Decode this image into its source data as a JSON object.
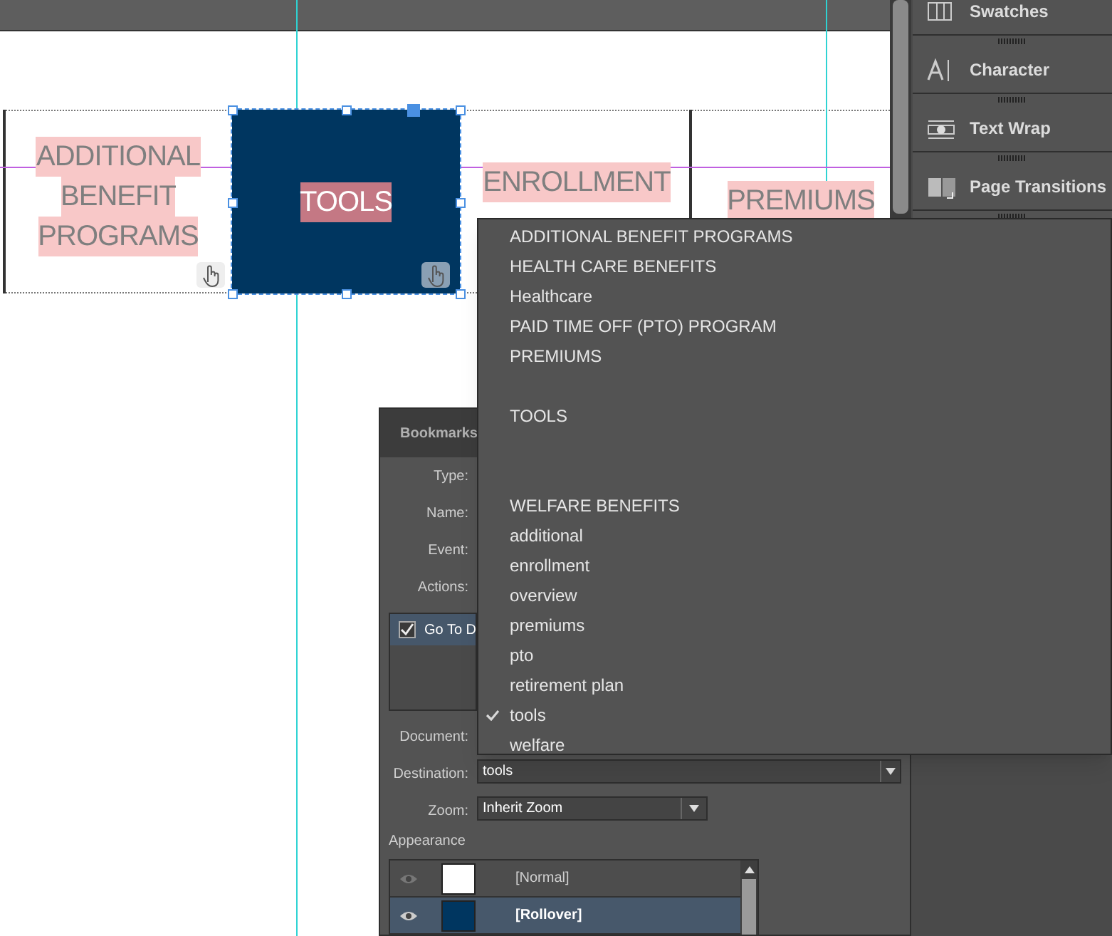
{
  "canvas_buttons": [
    {
      "lines": [
        "ADDITIONAL",
        "BENEFIT",
        "PROGRAMS"
      ],
      "selected": false,
      "hand_icon": true
    },
    {
      "lines": [
        "TOOLS"
      ],
      "selected": true,
      "hand_icon": true
    },
    {
      "lines": [
        "ENROLLMENT"
      ],
      "selected": false,
      "hand_icon": false
    },
    {
      "lines": [
        "PREMIUMS"
      ],
      "selected": false,
      "hand_icon": false
    }
  ],
  "side_panels": [
    {
      "kind": "swatches",
      "label": "Swatches"
    },
    {
      "kind": "character",
      "label": "Character"
    },
    {
      "kind": "text-wrap",
      "label": "Text Wrap"
    },
    {
      "kind": "page-transitions",
      "label": "Page Transitions"
    }
  ],
  "bookmarks_panel": {
    "title": "Bookmarks",
    "field_labels": [
      "Type:",
      "Name:",
      "Event:",
      "Actions:"
    ],
    "actions": [
      {
        "label": "Go To D",
        "checked": true
      }
    ],
    "document_label": "Document:",
    "destination": {
      "label": "Destination:",
      "value": "tools"
    },
    "zoom": {
      "label": "Zoom:",
      "value": "Inherit Zoom"
    },
    "appearance_label": "Appearance",
    "appearance": [
      {
        "label": "[Normal]",
        "selected": false,
        "color": "#ffffff"
      },
      {
        "label": "[Rollover]",
        "selected": true,
        "color": "#003660"
      }
    ]
  },
  "dropdown_menu": [
    {
      "kind": "item",
      "label": "ADDITIONAL BENEFIT PROGRAMS",
      "checked": false
    },
    {
      "kind": "item",
      "label": "HEALTH CARE BENEFITS",
      "checked": false
    },
    {
      "kind": "item",
      "label": "Healthcare",
      "checked": false
    },
    {
      "kind": "item",
      "label": "PAID TIME OFF (PTO) PROGRAM",
      "checked": false
    },
    {
      "kind": "item",
      "label": "PREMIUMS",
      "checked": false
    },
    {
      "kind": "blank"
    },
    {
      "kind": "item",
      "label": "TOOLS",
      "checked": false
    },
    {
      "kind": "blank"
    },
    {
      "kind": "blank"
    },
    {
      "kind": "item",
      "label": "WELFARE BENEFITS",
      "checked": false
    },
    {
      "kind": "item",
      "label": "additional",
      "checked": false
    },
    {
      "kind": "item",
      "label": "enrollment",
      "checked": false
    },
    {
      "kind": "item",
      "label": "overview",
      "checked": false
    },
    {
      "kind": "item",
      "label": "premiums",
      "checked": false
    },
    {
      "kind": "item",
      "label": "pto",
      "checked": false
    },
    {
      "kind": "item",
      "label": "retirement plan",
      "checked": false
    },
    {
      "kind": "item",
      "label": "tools",
      "checked": true
    },
    {
      "kind": "item",
      "label": "welfare",
      "checked": false
    }
  ]
}
